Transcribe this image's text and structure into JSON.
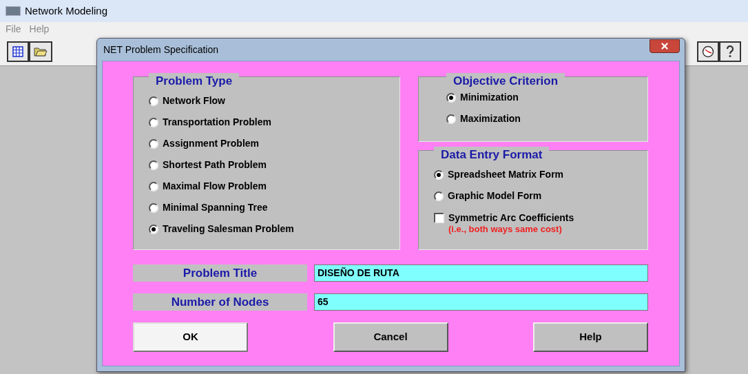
{
  "window": {
    "title": "Network Modeling"
  },
  "menu": [
    {
      "label": "File"
    },
    {
      "label": "Help"
    }
  ],
  "dialog": {
    "title": "NET Problem Specification",
    "problem_type": {
      "title": "Problem Type",
      "options": [
        {
          "label": "Network Flow",
          "selected": false
        },
        {
          "label": "Transportation Problem",
          "selected": false
        },
        {
          "label": "Assignment Problem",
          "selected": false
        },
        {
          "label": "Shortest Path Problem",
          "selected": false
        },
        {
          "label": "Maximal Flow Problem",
          "selected": false
        },
        {
          "label": "Minimal Spanning Tree",
          "selected": false
        },
        {
          "label": "Traveling Salesman Problem",
          "selected": true
        }
      ]
    },
    "objective": {
      "title": "Objective Criterion",
      "options": [
        {
          "label": "Minimization",
          "selected": true
        },
        {
          "label": "Maximization",
          "selected": false
        }
      ]
    },
    "data_entry": {
      "title": "Data Entry Format",
      "options": [
        {
          "label": "Spreadsheet Matrix Form",
          "selected": true
        },
        {
          "label": "Graphic Model Form",
          "selected": false
        }
      ],
      "symmetric": {
        "label": "Symmetric Arc Coefficients",
        "note": "(i.e., both ways same cost)",
        "checked": false
      }
    },
    "fields": [
      {
        "label": "Problem Title",
        "value": "DISEÑO DE RUTA"
      },
      {
        "label": "Number of Nodes",
        "value": "65"
      }
    ],
    "buttons": [
      {
        "label": "OK",
        "default": true
      },
      {
        "label": "Cancel",
        "default": false
      },
      {
        "label": "Help",
        "default": false
      }
    ]
  }
}
